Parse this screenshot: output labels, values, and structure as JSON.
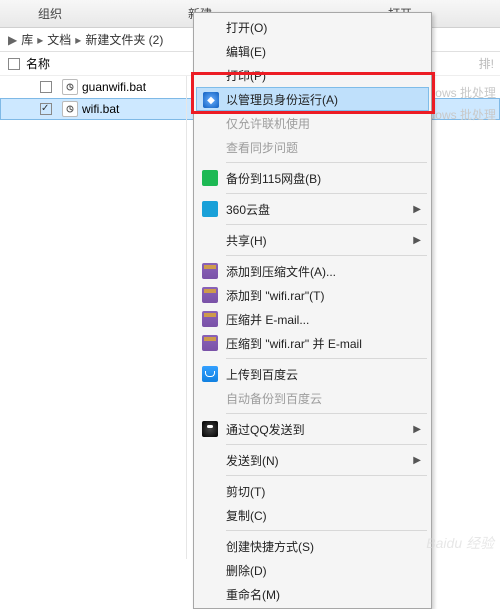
{
  "toolbar": {
    "organize": "组织",
    "new": "新建",
    "open": "打开"
  },
  "breadcrumb": {
    "s1": "库",
    "s2": "文档",
    "s3": "新建文件夹 (2)",
    "arrow": "▶",
    "chev": "▸"
  },
  "header": {
    "name": "名称",
    "badge": "排!"
  },
  "files": [
    {
      "name": "guanwifi.bat",
      "sel": false
    },
    {
      "name": "wifi.bat",
      "sel": true
    }
  ],
  "bg": {
    "r1": "indows 批处理",
    "r2": "indows 批处理"
  },
  "menu": {
    "open": "打开(O)",
    "edit": "编辑(E)",
    "print": "打印(P)",
    "runas": "以管理员身份运行(A)",
    "onlyonline": "仅允许联机使用",
    "syncissue": "查看同步问题",
    "backup115": "备份到115网盘(B)",
    "yun360": "360云盘",
    "share": "共享(H)",
    "rar_add": "添加到压缩文件(A)...",
    "rar_addwifi": "添加到 \"wifi.rar\"(T)",
    "rar_email": "压缩并 E-mail...",
    "rar_emailwifi": "压缩到 \"wifi.rar\" 并 E-mail",
    "baidu_up": "上传到百度云",
    "baidu_auto": "自动备份到百度云",
    "qq": "通过QQ发送到",
    "sendto": "发送到(N)",
    "cut": "剪切(T)",
    "copy": "复制(C)",
    "shortcut": "创建快捷方式(S)",
    "delete": "删除(D)",
    "rename": "重命名(M)"
  },
  "watermark": "Baidu 经验"
}
